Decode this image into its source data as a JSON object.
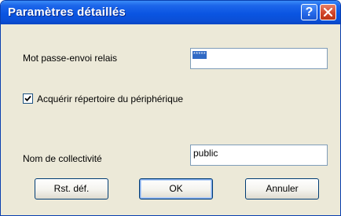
{
  "window": {
    "title": "Paramètres détaillés",
    "help_label": "?"
  },
  "fields": {
    "relay_password": {
      "label": "Mot passe-envoi relais",
      "value": "*****"
    },
    "acquire_directory": {
      "label": "Acquérir répertoire du périphérique",
      "checked": true
    },
    "community_name": {
      "label": "Nom de collectivité",
      "value": "public"
    }
  },
  "buttons": {
    "reset_label": "Rst. déf.",
    "ok_label": "OK",
    "cancel_label": "Annuler"
  },
  "colors": {
    "titlebar": "#0a55e2",
    "dialog_bg": "#ece9d8",
    "selection": "#316ac5",
    "close_button": "#d2452a"
  }
}
